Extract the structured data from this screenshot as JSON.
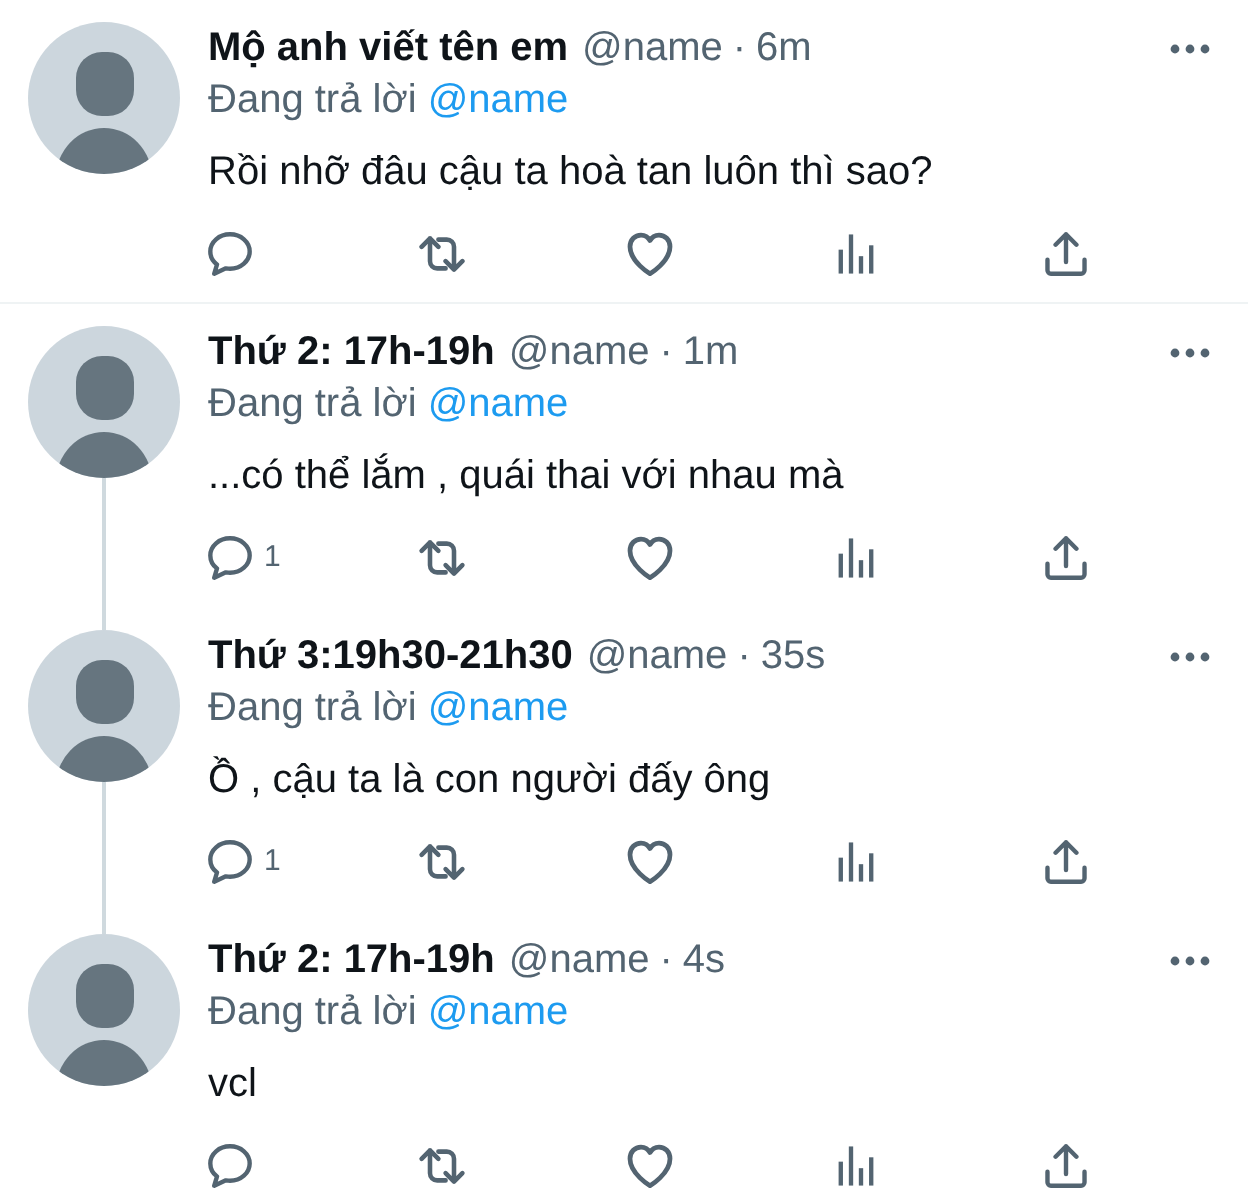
{
  "conversations": [
    {
      "tweets": [
        {
          "display_name": "Mộ anh viết tên em",
          "handle": "@name",
          "separator": "·",
          "time": "6m",
          "replying_label": "Đang trả lời",
          "replying_to": "@name",
          "text": "Rồi nhỡ đâu cậu ta hoà tan luôn thì sao?"
        }
      ]
    },
    {
      "tweets": [
        {
          "display_name": "Thứ 2: 17h-19h",
          "handle": "@name",
          "separator": "·",
          "time": "1m",
          "replying_label": "Đang trả lời",
          "replying_to": "@name",
          "text": "...có thể lắm , quái thai với nhau mà",
          "reply_count": "1"
        },
        {
          "display_name": "Thứ 3:19h30-21h30",
          "handle": "@name",
          "separator": "·",
          "time": "35s",
          "replying_label": "Đang trả lời",
          "replying_to": "@name",
          "text": "Ồ , cậu ta là con người đấy ông",
          "reply_count": "1"
        },
        {
          "display_name": "Thứ 2: 17h-19h",
          "handle": "@name",
          "separator": "·",
          "time": "4s",
          "replying_label": "Đang trả lời",
          "replying_to": "@name",
          "text": "vcl"
        }
      ]
    }
  ]
}
